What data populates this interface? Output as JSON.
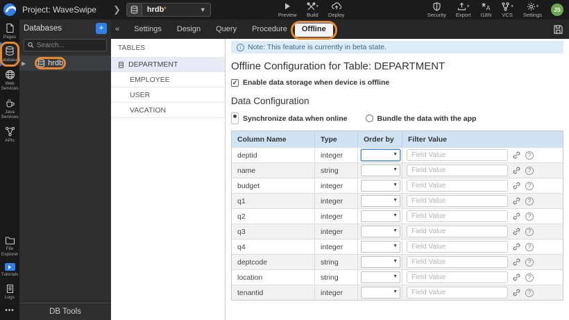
{
  "topbar": {
    "project_label": "Project: WaveSwipe",
    "db_select": {
      "value": "hrdb",
      "dirty_marker": "*"
    },
    "actions_left": [
      {
        "label": "Preview"
      },
      {
        "label": "Build"
      },
      {
        "label": "Deploy"
      }
    ],
    "actions_right": [
      {
        "label": "Security"
      },
      {
        "label": "Export"
      },
      {
        "label": "I18N"
      },
      {
        "label": "VCS"
      },
      {
        "label": "Settings"
      }
    ],
    "avatar_initials": "JS"
  },
  "rail": {
    "items": [
      {
        "label": "Pages"
      },
      {
        "label": "Databases",
        "active": true
      },
      {
        "label": "Web Services"
      },
      {
        "label": "Java Services"
      },
      {
        "label": "APIs"
      }
    ],
    "bottom_items": [
      {
        "label": "File Explorer"
      },
      {
        "label": "Tutorials"
      },
      {
        "label": "Logs"
      }
    ],
    "more_label": "•••"
  },
  "db_panel": {
    "title": "Databases",
    "add_button": "+",
    "collapse_button": "«",
    "search_placeholder": "Search...",
    "items": [
      {
        "label": "hrdb"
      }
    ],
    "footer": "DB Tools"
  },
  "tabs": {
    "items": [
      {
        "label": "Settings"
      },
      {
        "label": "Design"
      },
      {
        "label": "Query"
      },
      {
        "label": "Procedure"
      },
      {
        "label": "Offline",
        "active": true
      }
    ]
  },
  "tables_panel": {
    "title": "TABLES",
    "items": [
      {
        "label": "DEPARTMENT",
        "selected": true
      },
      {
        "label": "EMPLOYEE"
      },
      {
        "label": "USER"
      },
      {
        "label": "VACATION"
      }
    ]
  },
  "main": {
    "note": "Note: This feature is currently in beta state.",
    "title": "Offline Configuration for Table: DEPARTMENT",
    "enable_checkbox": {
      "label": "Enable data storage when device is offline",
      "checked": true,
      "check_glyph": "✓"
    },
    "section_title": "Data Configuration",
    "radios": [
      {
        "label": "Synchronize data when online",
        "selected": true
      },
      {
        "label": "Bundle the data with the app",
        "selected": false
      }
    ],
    "table": {
      "headers": [
        "Column Name",
        "Type",
        "Order by",
        "Filter Value"
      ],
      "filter_placeholder": "Field Value",
      "rows": [
        {
          "name": "deptid",
          "type": "integer"
        },
        {
          "name": "name",
          "type": "string"
        },
        {
          "name": "budget",
          "type": "integer"
        },
        {
          "name": "q1",
          "type": "integer"
        },
        {
          "name": "q2",
          "type": "integer"
        },
        {
          "name": "q3",
          "type": "integer"
        },
        {
          "name": "q4",
          "type": "integer"
        },
        {
          "name": "deptcode",
          "type": "string"
        },
        {
          "name": "location",
          "type": "string"
        },
        {
          "name": "tenantid",
          "type": "integer"
        }
      ]
    }
  },
  "colors": {
    "accent_blue": "#2f80e8",
    "annotation_orange": "#e8872e",
    "avatar_green": "#6aa84f",
    "selected_table_lavender": "#eae9f7",
    "grid_header_blue": "#cfe3f4",
    "note_banner_blue": "#ddecf9"
  }
}
